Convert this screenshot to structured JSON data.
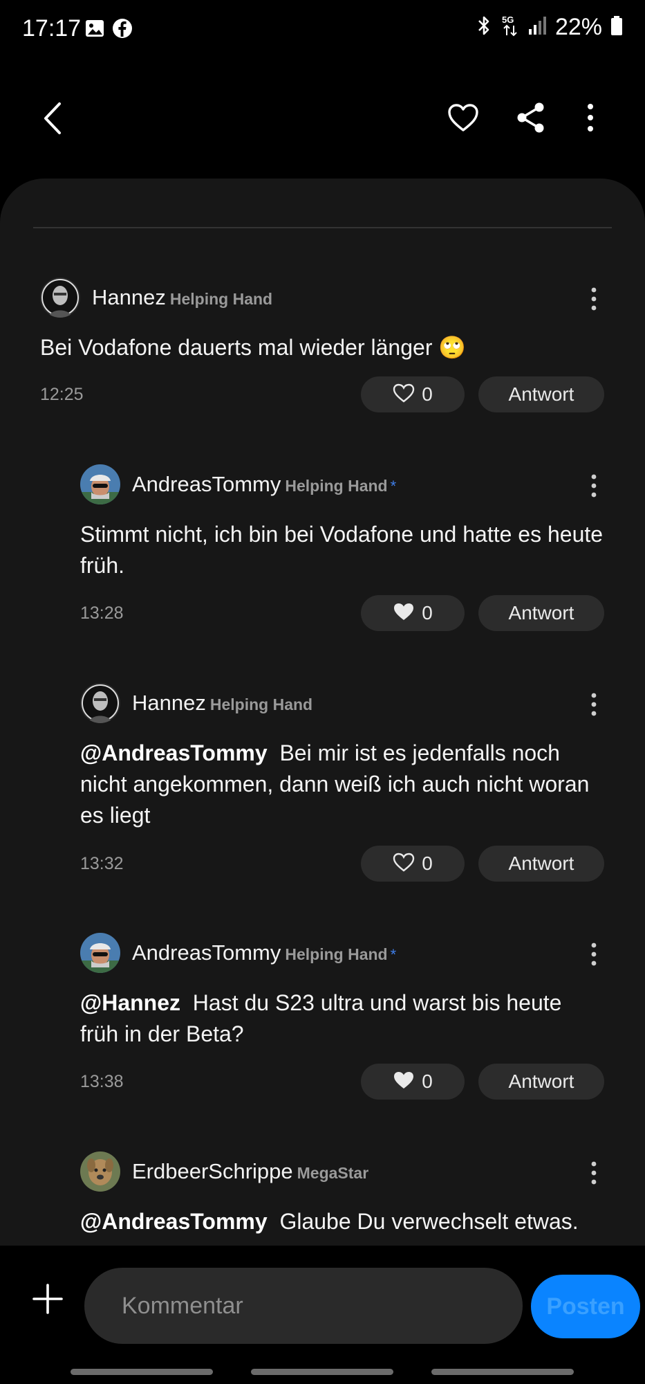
{
  "status_bar": {
    "time": "17:17",
    "left_icons": [
      "image-icon",
      "facebook-icon"
    ],
    "right_icons": [
      "bluetooth-icon",
      "5g-icon",
      "signal-icon",
      "battery-icon"
    ],
    "battery_text": "22%"
  },
  "top_bar": {
    "icons": [
      "back-icon",
      "heart-icon",
      "share-icon",
      "more-icon"
    ]
  },
  "comments": [
    {
      "username": "Hannez",
      "badge": "Helping Hand",
      "verified": false,
      "mention": "",
      "text": "Bei Vodafone dauerts mal wieder länger 🙄",
      "time": "12:25",
      "likes": "0",
      "liked": false,
      "reply_label": "Antwort"
    },
    {
      "username": "AndreasTommy",
      "badge": "Helping Hand",
      "verified": true,
      "mention": "",
      "text": "Stimmt nicht, ich bin bei Vodafone und hatte es heute früh.",
      "time": "13:28",
      "likes": "0",
      "liked": true,
      "reply_label": "Antwort"
    },
    {
      "username": "Hannez",
      "badge": "Helping Hand",
      "verified": false,
      "mention": "@AndreasTommy",
      "text": "Bei mir ist es jedenfalls noch nicht angekommen, dann weiß ich auch nicht woran es liegt",
      "time": "13:32",
      "likes": "0",
      "liked": false,
      "reply_label": "Antwort"
    },
    {
      "username": "AndreasTommy",
      "badge": "Helping Hand",
      "verified": true,
      "mention": "@Hannez",
      "text": "Hast du S23 ultra und warst bis heute früh in der Beta?",
      "time": "13:38",
      "likes": "0",
      "liked": true,
      "reply_label": "Antwort"
    },
    {
      "username": "ErdbeerSchrippe",
      "badge": "MegaStar",
      "verified": false,
      "mention": "@AndreasTommy",
      "text": "Glaube Du verwechselt etwas.",
      "time": "",
      "likes": "",
      "liked": false,
      "reply_label": ""
    }
  ],
  "verified_star": "*",
  "composer": {
    "placeholder": "Kommentar",
    "post_label": "Posten"
  },
  "colors": {
    "background": "#000000",
    "sheet": "#171717",
    "pill": "#2c2c2c",
    "accent": "#0a84ff",
    "badge_text": "#9a9a9a",
    "verified_star": "#3f7ee8"
  }
}
